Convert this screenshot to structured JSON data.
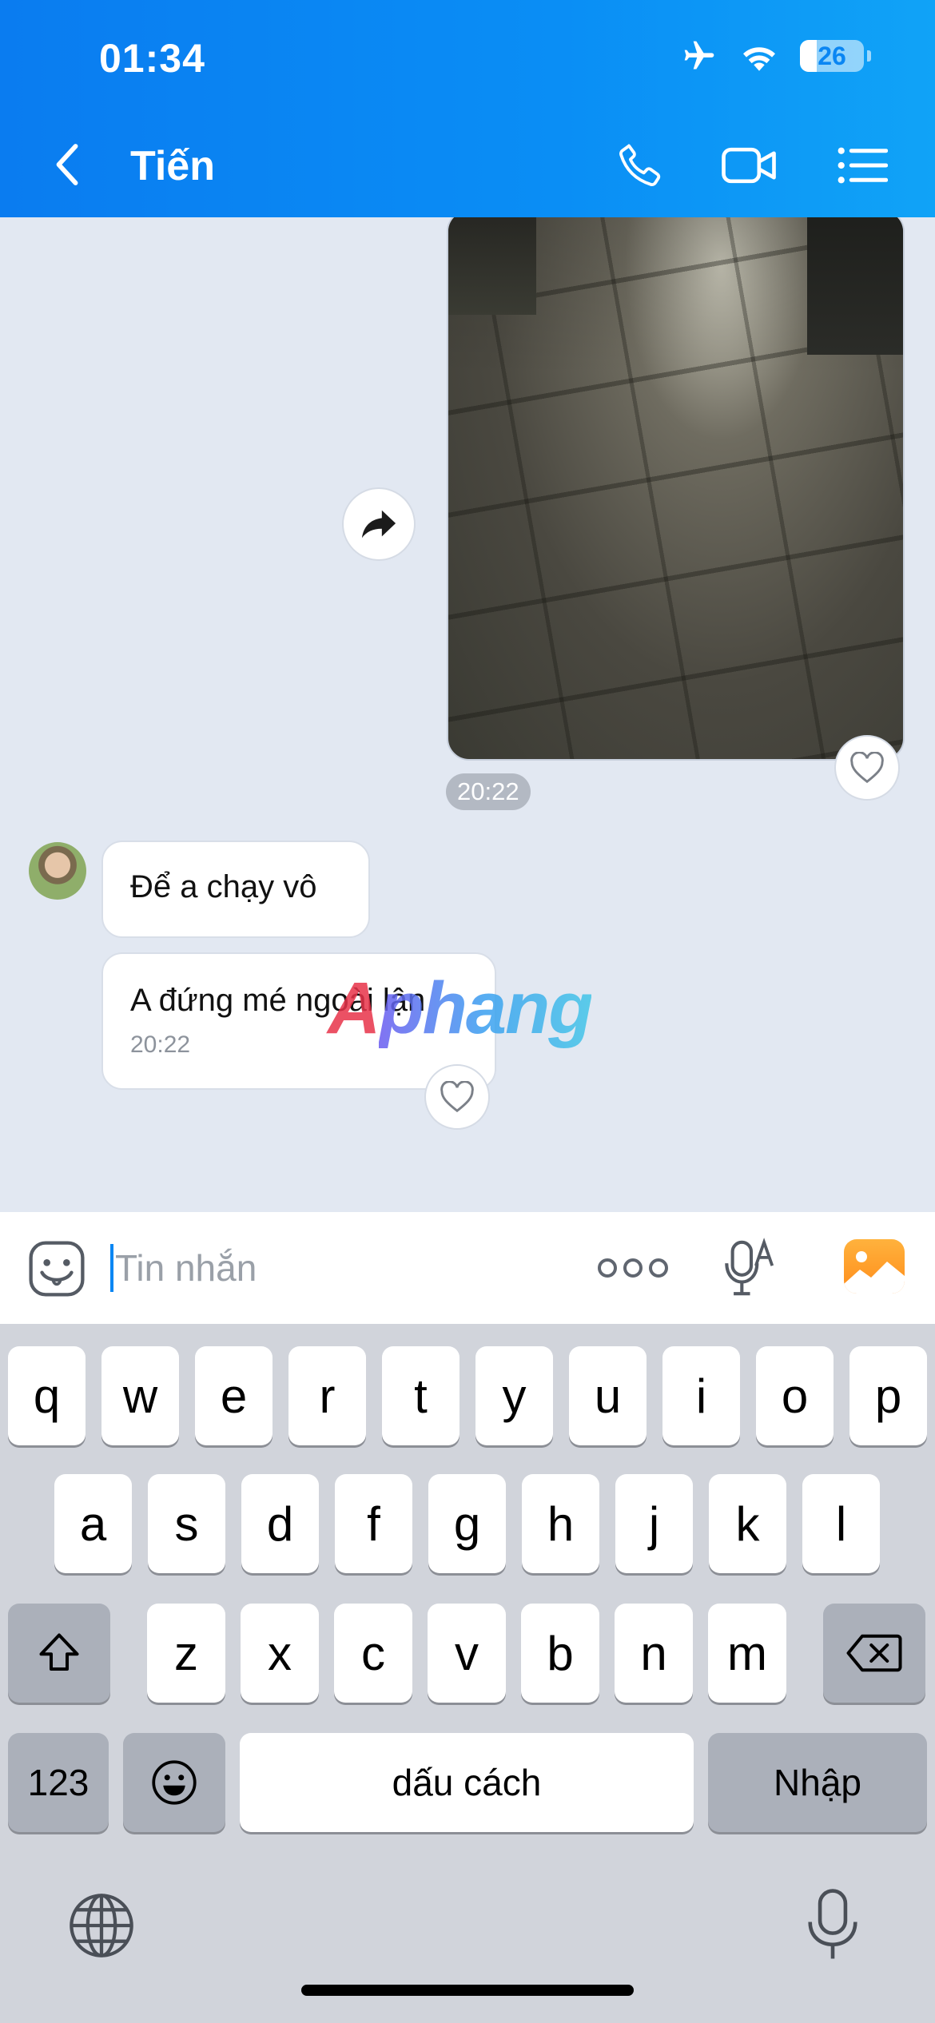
{
  "status_bar": {
    "time": "01:34",
    "battery_level": "26",
    "battery_fraction": 0.26
  },
  "header": {
    "contact_name": "Tiến",
    "icons": [
      "chevron-left-icon",
      "phone-icon",
      "video-camera-icon",
      "list-menu-icon"
    ]
  },
  "messages": {
    "outgoing_video": {
      "type": "video",
      "time": "20:22"
    },
    "incoming": [
      {
        "text": "Để a chạy vô"
      },
      {
        "text": "A đứng mé ngoài lận",
        "time": "20:22"
      }
    ],
    "watermark": {
      "part1": "A",
      "part2": "phang"
    }
  },
  "input_bar": {
    "placeholder": "Tin nhắn"
  },
  "keyboard": {
    "row1": [
      "q",
      "w",
      "e",
      "r",
      "t",
      "y",
      "u",
      "i",
      "o",
      "p"
    ],
    "row2": [
      "a",
      "s",
      "d",
      "f",
      "g",
      "h",
      "j",
      "k",
      "l"
    ],
    "row3": [
      "z",
      "x",
      "c",
      "v",
      "b",
      "n",
      "m"
    ],
    "numbers_key": "123",
    "space_key": "dấu cách",
    "return_key": "Nhập"
  },
  "colors": {
    "header_blue": "#0a86f3",
    "chat_bg": "#e2e8f2",
    "keyboard_bg": "#d1d4db",
    "accent_orange": "#ff9a26"
  }
}
